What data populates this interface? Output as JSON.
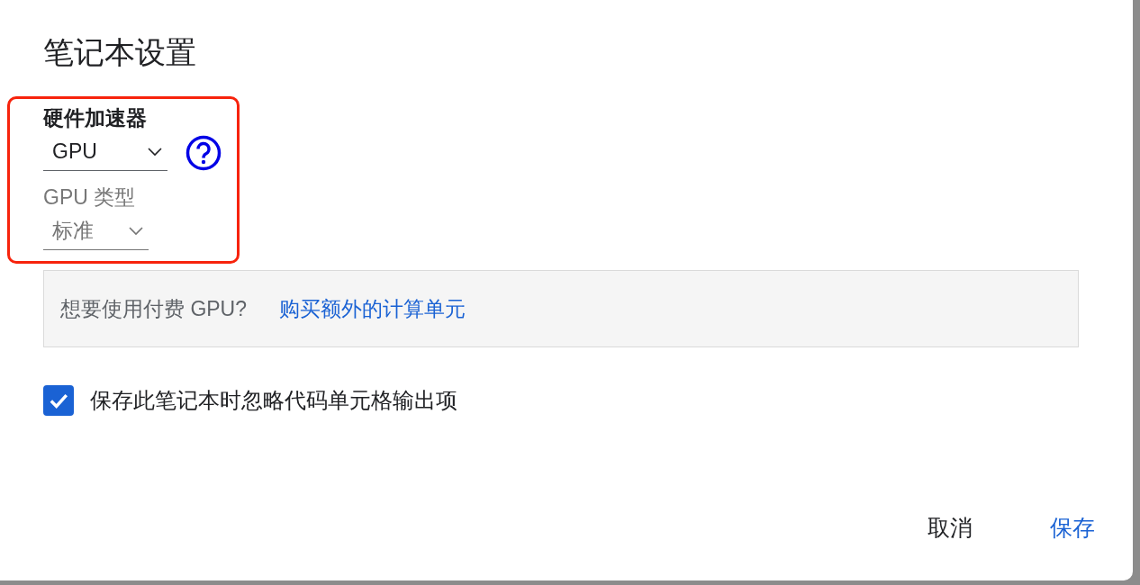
{
  "dialog": {
    "title": "笔记本设置"
  },
  "hardware_accelerator": {
    "label": "硬件加速器",
    "value": "GPU",
    "disabled": false,
    "highlighted": true
  },
  "gpu_type": {
    "label": "GPU 类型",
    "value": "标准",
    "disabled": true
  },
  "info": {
    "text": "想要使用付费 GPU?",
    "link": "购买额外的计算单元"
  },
  "checkbox": {
    "label": "保存此笔记本时忽略代码单元格输出项",
    "checked": true
  },
  "buttons": [
    {
      "label": "取消",
      "kind": "secondary"
    },
    {
      "label": "保存",
      "kind": "primary"
    }
  ]
}
